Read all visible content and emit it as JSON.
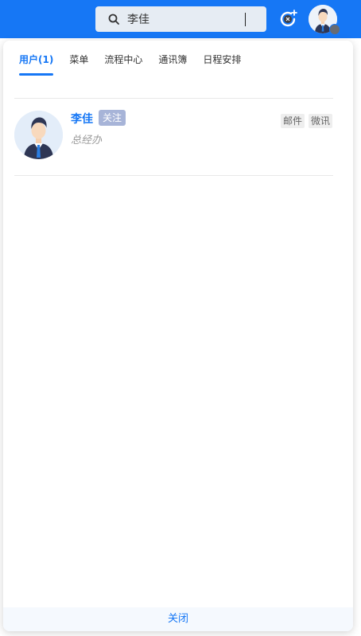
{
  "header": {
    "search": {
      "value": "李佳",
      "placeholder": ""
    },
    "refresh_icon": "refresh-add-icon",
    "avatar_icon": "user-avatar-icon",
    "brand_color": "#1677f5"
  },
  "panel": {
    "tabs": [
      {
        "label": "用户(1)",
        "active": true
      },
      {
        "label": "菜单",
        "active": false
      },
      {
        "label": "流程中心",
        "active": false
      },
      {
        "label": "通讯簿",
        "active": false
      },
      {
        "label": "日程安排",
        "active": false
      }
    ],
    "result": {
      "name": "李佳",
      "follow_label": "关注",
      "department": "总经办",
      "actions": [
        "邮件",
        "微讯"
      ]
    },
    "close_label": "关闭"
  }
}
